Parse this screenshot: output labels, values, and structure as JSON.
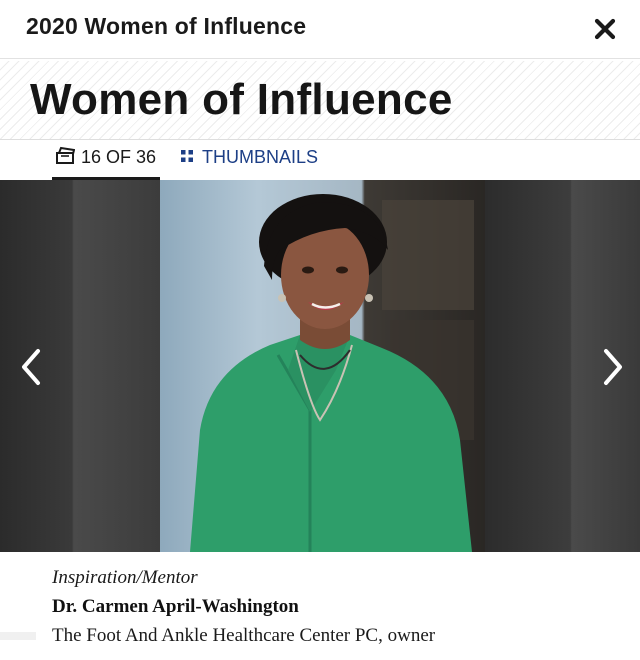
{
  "header": {
    "title": "2020 Women of Influence"
  },
  "banner": {
    "heading": "Women of Influence"
  },
  "tabs": {
    "count_label": "16 OF 36",
    "thumbnails_label": "THUMBNAILS"
  },
  "slide": {
    "current": 16,
    "total": 36
  },
  "caption": {
    "category": "Inspiration/Mentor",
    "name": "Dr. Carmen April-Washington",
    "role": "The Foot And Ankle Healthcare Center PC, owner"
  },
  "colors": {
    "accent_link": "#1d3f86",
    "shirt": "#2e9e6a",
    "stage_bg": "#1b1b1b"
  },
  "icons": {
    "close": "close-icon",
    "count": "slides-stack-icon",
    "thumbnails": "grid-icon",
    "prev": "chevron-left-icon",
    "next": "chevron-right-icon"
  }
}
